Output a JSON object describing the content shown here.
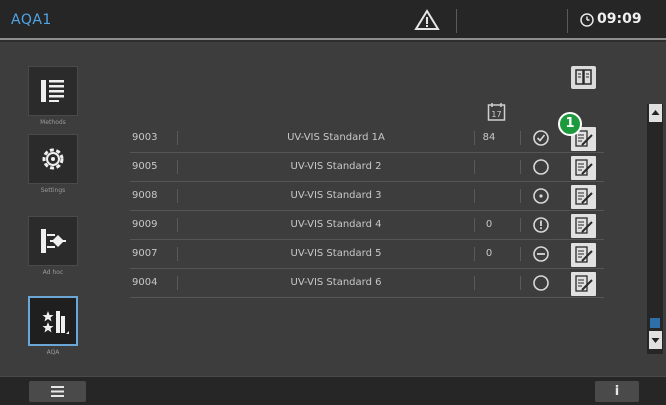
{
  "header": {
    "title": "AQA1",
    "time": "09:09",
    "warning_icon": "warning-triangle-icon",
    "clock_icon": "clock-icon"
  },
  "sidebar": {
    "items": [
      {
        "label": "Methods",
        "icon": "methods-list-icon"
      },
      {
        "label": "Settings",
        "icon": "settings-gear-icon"
      },
      {
        "label": "Ad hoc",
        "icon": "adhoc-test-icon"
      },
      {
        "label": "AQA",
        "icon": "aqa-sparkle-icon",
        "active": true
      }
    ]
  },
  "table": {
    "count_header_icon": "calendar-17-icon",
    "calendar_day": "17",
    "rows": [
      {
        "id": "9003",
        "name": "UV-VIS Standard 1A",
        "count": "84",
        "status": "check-circle-icon"
      },
      {
        "id": "9005",
        "name": "UV-VIS Standard 2",
        "count": "",
        "status": "empty-circle-icon"
      },
      {
        "id": "9008",
        "name": "UV-VIS Standard 3",
        "count": "",
        "status": "dot-circle-icon"
      },
      {
        "id": "9009",
        "name": "UV-VIS Standard 4",
        "count": "0",
        "status": "alert-circle-icon"
      },
      {
        "id": "9007",
        "name": "UV-VIS Standard 5",
        "count": "0",
        "status": "minus-circle-icon"
      },
      {
        "id": "9004",
        "name": "UV-VIS Standard 6",
        "count": "",
        "status": "empty-circle-icon"
      }
    ]
  },
  "callout": "1",
  "bottom": {
    "info_label": "i",
    "menu_icon": "hamburger-menu-icon"
  },
  "colors": {
    "accent": "#4fa5e6",
    "callout": "#1e9a3e",
    "active_border": "#6aa6d6"
  }
}
